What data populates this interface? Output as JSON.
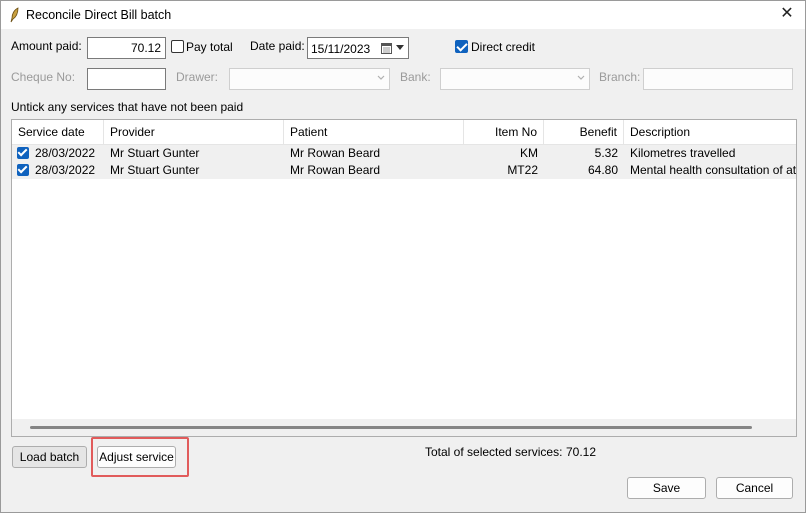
{
  "window": {
    "title": "Reconcile Direct Bill batch"
  },
  "payment": {
    "amount_label": "Amount paid:",
    "amount_value": "70.12",
    "pay_total_label": "Pay total",
    "date_label": "Date paid:",
    "date_value": "15/11/2023",
    "direct_credit_label": "Direct credit",
    "cheque_label": "Cheque No:",
    "drawer_label": "Drawer:",
    "bank_label": "Bank:",
    "branch_label": "Branch:"
  },
  "instructions": "Untick any services that have not been paid",
  "table": {
    "columns": {
      "service_date": "Service date",
      "provider": "Provider",
      "patient": "Patient",
      "item_no": "Item No",
      "benefit": "Benefit",
      "description": "Description"
    },
    "rows": [
      {
        "service_date": "28/03/2022",
        "provider": "Mr Stuart Gunter",
        "patient": "Mr Rowan Beard",
        "item_no": "KM",
        "benefit": "5.32",
        "description": "Kilometres travelled"
      },
      {
        "service_date": "28/03/2022",
        "provider": "Mr Stuart Gunter",
        "patient": "Mr Rowan Beard",
        "item_no": "MT22",
        "benefit": "64.80",
        "description": "Mental health consultation of at leas"
      }
    ]
  },
  "buttons": {
    "load_batch": "Load batch",
    "adjust_service": "Adjust service",
    "save": "Save",
    "cancel": "Cancel"
  },
  "total": {
    "label": "Total of selected services:",
    "value": "70.12"
  }
}
